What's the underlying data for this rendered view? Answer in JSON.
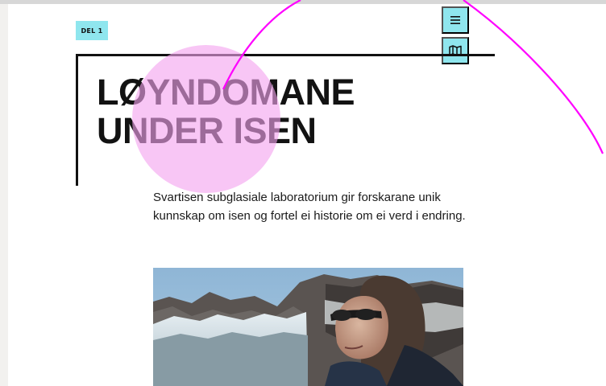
{
  "section": {
    "badge": "DEL 1"
  },
  "nav": {
    "menu_icon": "hamburger-menu-icon",
    "map_icon": "map-icon"
  },
  "article": {
    "title_line1": "LØYNDOMANE",
    "title_line2": "UNDER ISEN",
    "lead": "Svartisen subglasiale laboratorium gir forskarane unik kunnskap om isen og fortel ei historie om ei verd i endring.",
    "image_subject": "woman-with-sunglasses-glacier-photo"
  },
  "colors": {
    "accent": "#8fe6ee",
    "text": "#121212",
    "frame": "#111111",
    "highlight": "#f4a3ef",
    "annotation": "#ff00ff"
  }
}
